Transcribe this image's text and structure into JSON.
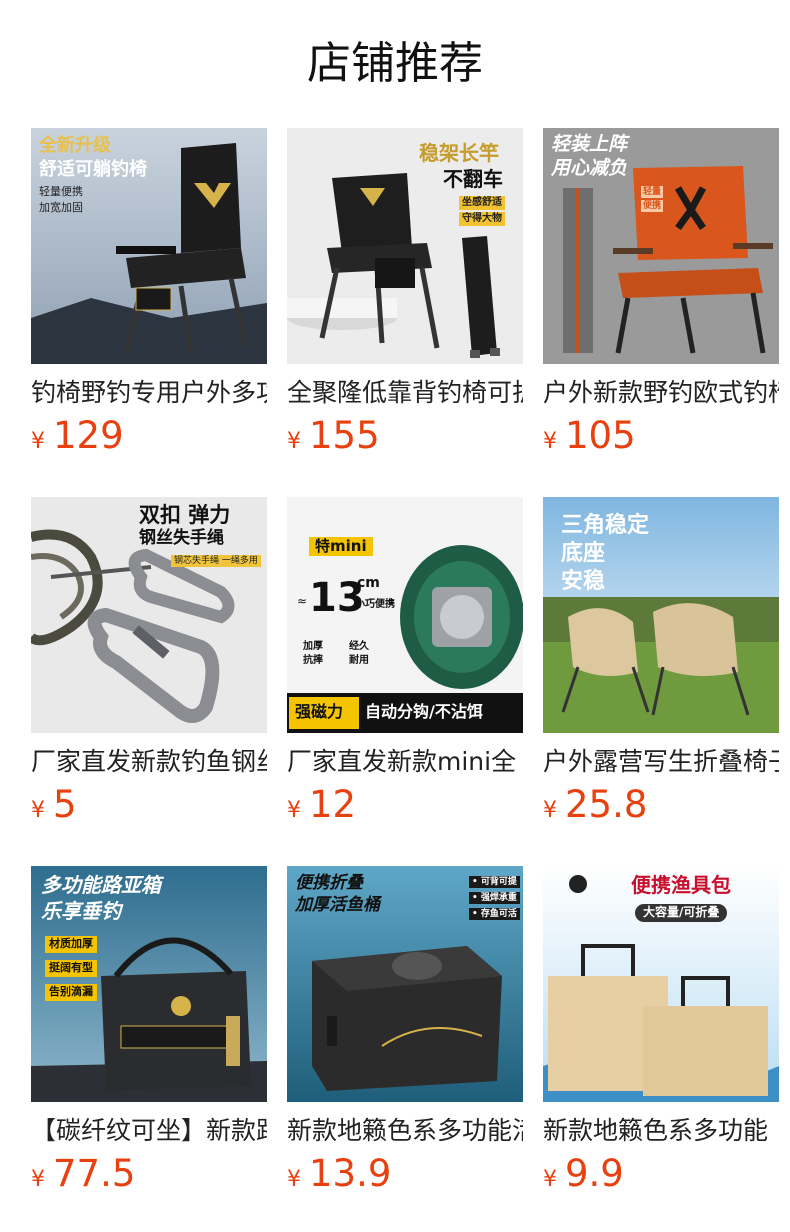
{
  "header": {
    "title": "店铺推荐"
  },
  "colors": {
    "price": "#e8410f",
    "text": "#222222"
  },
  "products": [
    {
      "title": "钓椅野钓专用户外多功能",
      "currency": "¥",
      "price": "129",
      "image_icon": "black-fishing-chair-icon",
      "image_text": [
        "全新升级",
        "舒适可躺钓椅",
        "轻量便携",
        "加宽加固"
      ]
    },
    {
      "title": "全聚隆低靠背钓椅可折叠",
      "currency": "¥",
      "price": "155",
      "image_icon": "folding-fishing-chair-icon",
      "image_text": [
        "稳架长竿",
        "不翻车",
        "坐感舒适",
        "守得大物"
      ]
    },
    {
      "title": "户外新款野钓欧式钓椅",
      "currency": "¥",
      "price": "105",
      "image_icon": "orange-fishing-chair-icon",
      "image_text": [
        "轻装上阵",
        "用心减负",
        "轻量",
        "便携"
      ]
    },
    {
      "title": "厂家直发新款钓鱼钢丝失手绳",
      "currency": "¥",
      "price": "5",
      "image_icon": "carabiner-rope-icon",
      "image_text": [
        "双扣 弹力",
        "钢丝失手绳",
        "钢芯失手绳 一绳多用"
      ]
    },
    {
      "title": "厂家直发新款mini全",
      "currency": "¥",
      "price": "12",
      "image_icon": "magnetic-hook-disc-icon",
      "image_text": [
        "特mini",
        "≈",
        "13",
        "cm",
        "小巧便携",
        "加厚",
        "抗摔",
        "经久",
        "耐用",
        "强磁力",
        "自动分钩/不沾饵"
      ]
    },
    {
      "title": "户外露营写生折叠椅子",
      "currency": "¥",
      "price": "25.8",
      "image_icon": "camping-chairs-icon",
      "image_text": [
        "三角稳定",
        "底座",
        "安稳"
      ]
    },
    {
      "title": "【碳纤纹可坐】新款路亚箱",
      "currency": "¥",
      "price": "77.5",
      "image_icon": "lure-box-icon",
      "image_text": [
        "多功能路亚箱",
        "乐享垂钓",
        "材质加厚",
        "挺阔有型",
        "告别滴漏"
      ]
    },
    {
      "title": "新款地籁色系多功能活鱼桶",
      "currency": "¥",
      "price": "13.9",
      "image_icon": "fish-bucket-icon",
      "image_text": [
        "便携折叠",
        "加厚活鱼桶",
        "• 可背可提",
        "• 强焊承重",
        "• 存鱼可活"
      ]
    },
    {
      "title": "新款地籁色系多功能",
      "currency": "¥",
      "price": "9.9",
      "image_icon": "tackle-bag-icon",
      "image_text": [
        "便携渔具包",
        "大容量/可折叠"
      ]
    }
  ]
}
